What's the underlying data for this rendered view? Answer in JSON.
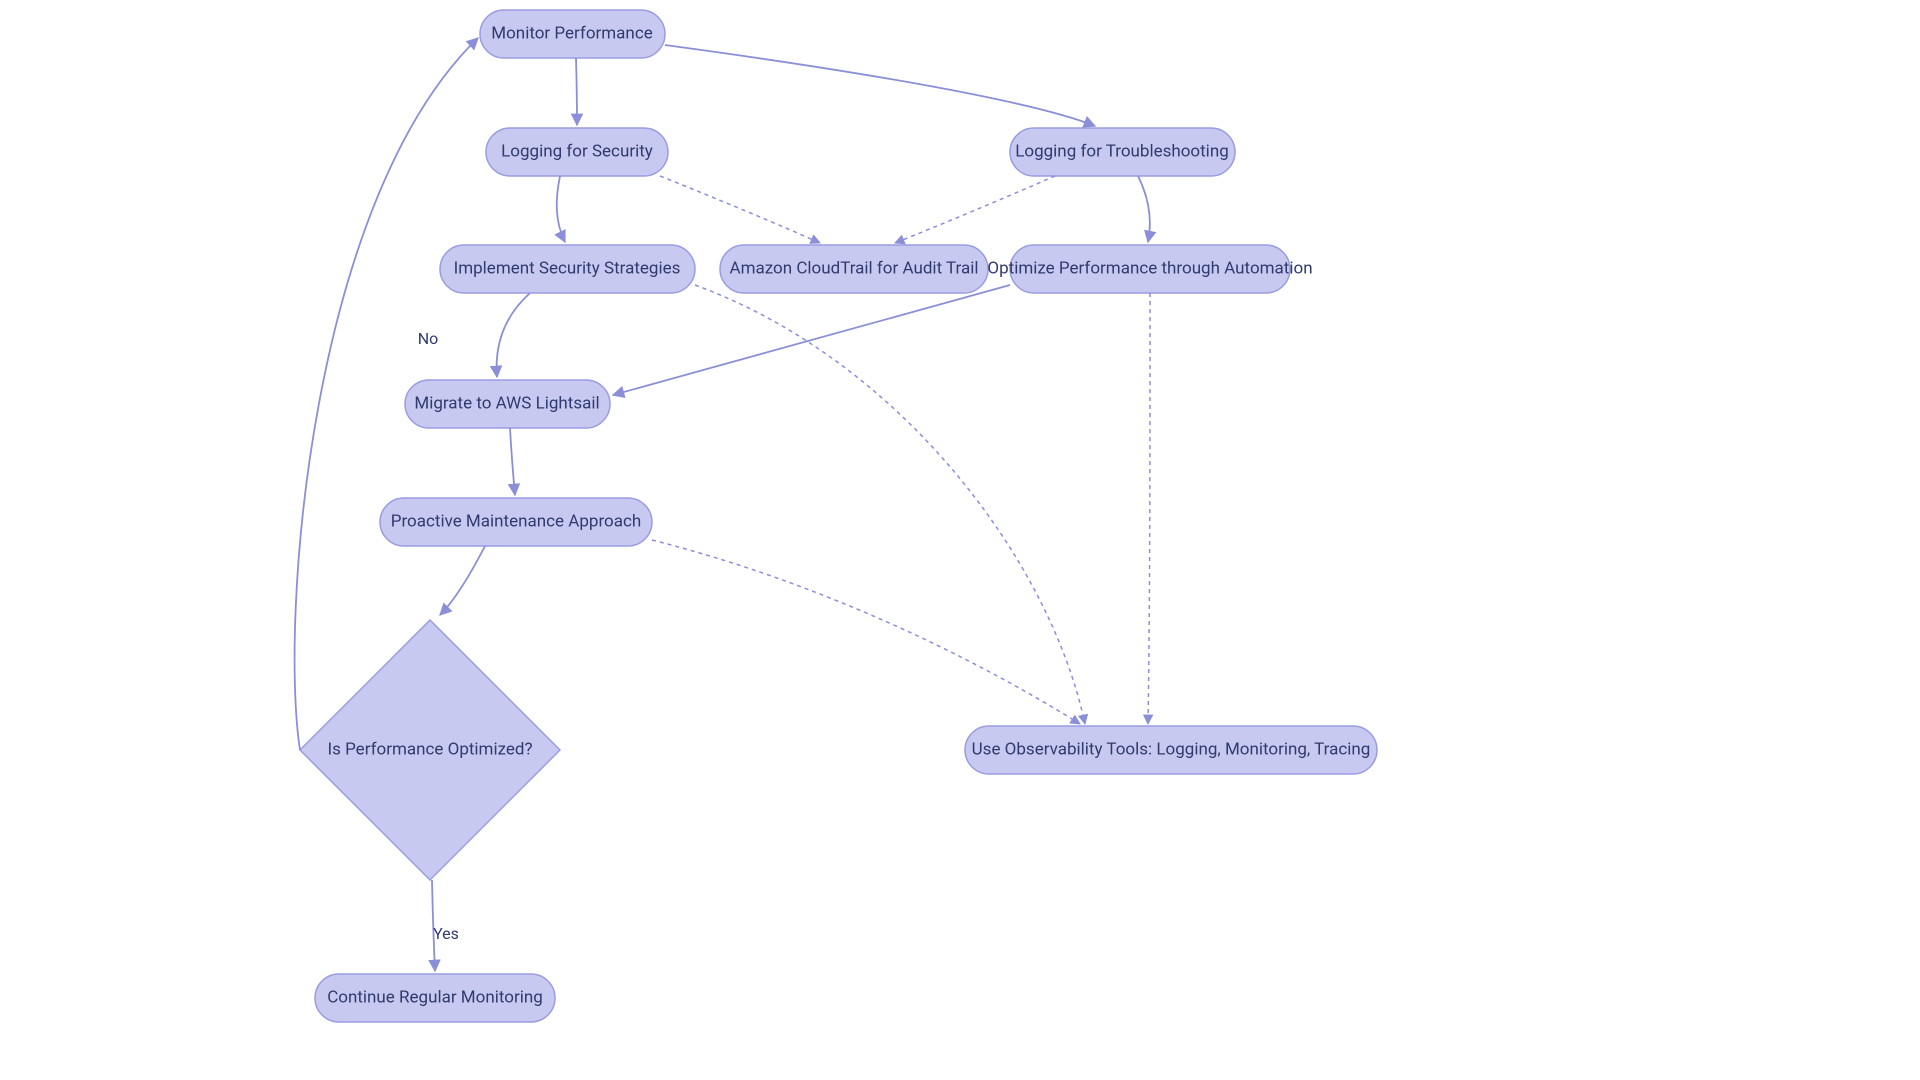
{
  "nodes": {
    "monitor": {
      "label": "Monitor Performance"
    },
    "logsec": {
      "label": "Logging for Security"
    },
    "logtrbl": {
      "label": "Logging for Troubleshooting"
    },
    "impsec": {
      "label": "Implement Security Strategies"
    },
    "cloudtrail": {
      "label": "Amazon CloudTrail for Audit Trail"
    },
    "optauto": {
      "label": "Optimize Performance through Automation"
    },
    "migrate": {
      "label": "Migrate to AWS Lightsail"
    },
    "proactive": {
      "label": "Proactive Maintenance Approach"
    },
    "decision": {
      "label": "Is Performance Optimized?"
    },
    "continue": {
      "label": "Continue Regular Monitoring"
    },
    "obstools": {
      "label": "Use Observability Tools: Logging, Monitoring, Tracing"
    }
  },
  "edge_labels": {
    "yes": "Yes",
    "no": "No"
  }
}
